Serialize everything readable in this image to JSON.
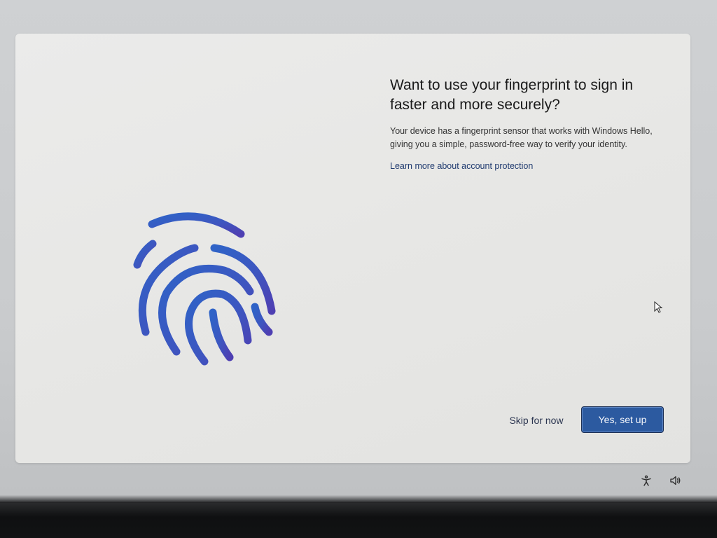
{
  "oobe": {
    "title": "Want to use your fingerprint to sign in faster and more securely?",
    "description": "Your device has a fingerprint sensor that works with Windows Hello, giving you a simple, password-free way to verify your identity.",
    "learn_more": "Learn more about account protection",
    "skip_label": "Skip for now",
    "primary_label": "Yes, set up",
    "illustration_icon": "fingerprint-icon",
    "accent_color": "#2c5aa0"
  },
  "system_tray": {
    "icons": [
      "accessibility-icon",
      "volume-icon"
    ]
  }
}
